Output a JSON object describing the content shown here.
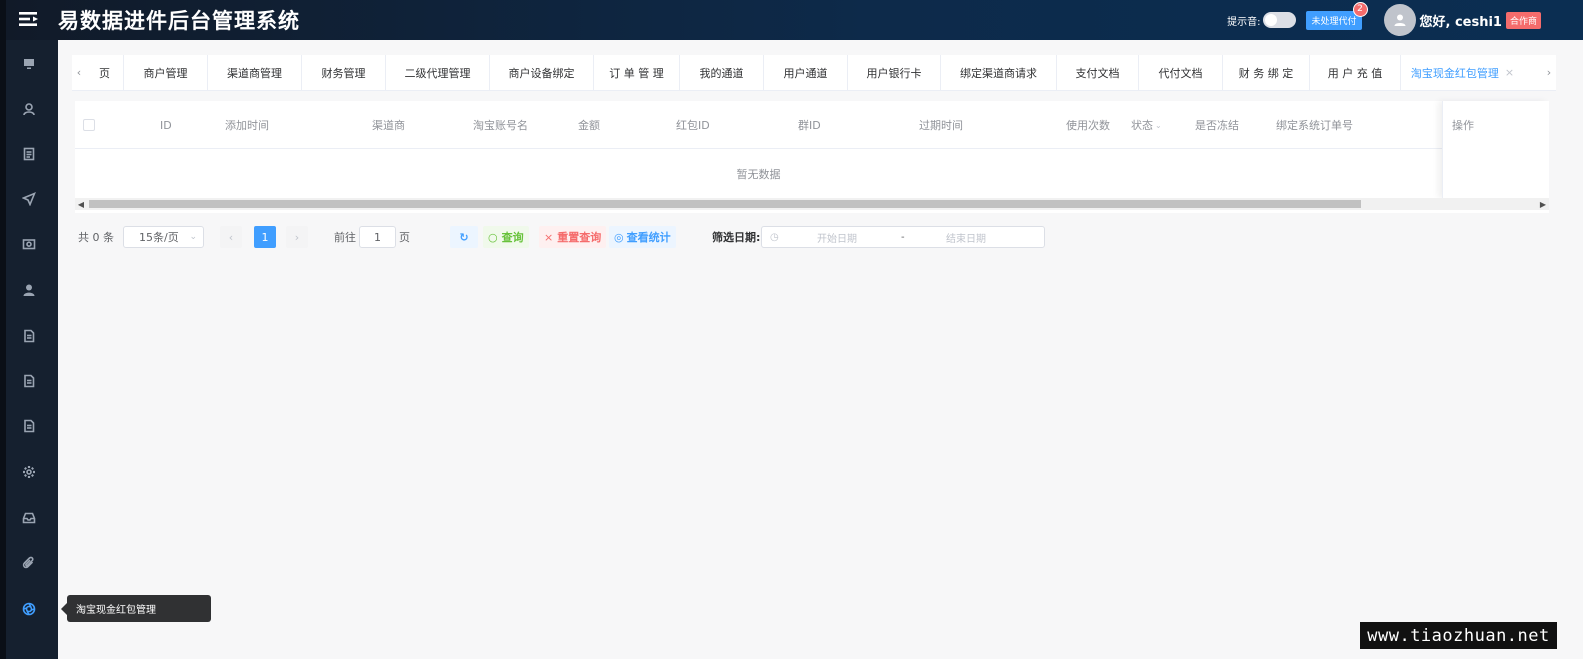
{
  "header": {
    "title": "易数据进件后台管理系统",
    "tone_label": "提示音:",
    "pending_button": "未处理代付",
    "pending_count": "2",
    "greeting": "您好, ceshi1",
    "role_badge": "合作商"
  },
  "sidebar": {
    "items": [
      {
        "icon": "monitor-icon"
      },
      {
        "icon": "user-icon"
      },
      {
        "icon": "document-icon"
      },
      {
        "icon": "send-icon"
      },
      {
        "icon": "wallet-icon"
      },
      {
        "icon": "person-icon"
      },
      {
        "icon": "file-icon"
      },
      {
        "icon": "file-icon"
      },
      {
        "icon": "file-icon"
      },
      {
        "icon": "gear-icon"
      },
      {
        "icon": "inbox-icon"
      },
      {
        "icon": "paperclip-icon"
      },
      {
        "icon": "aperture-icon",
        "active": true
      }
    ],
    "tooltip": "淘宝现金红包管理"
  },
  "tabs": {
    "items": [
      "页",
      "商户管理",
      "渠道商管理",
      "财务管理",
      "二级代理管理",
      "商户设备绑定",
      "订 单 管 理",
      "我的通道",
      "用户通道",
      "用户银行卡",
      "绑定渠道商请求",
      "支付文档",
      "代付文档",
      "财 务 绑 定",
      "用 户 充 值",
      "淘宝现金红包管理"
    ],
    "active_index": 15,
    "close_symbol": "×"
  },
  "table": {
    "columns": [
      "ID",
      "添加时间",
      "渠道商",
      "淘宝账号名",
      "金额",
      "红包ID",
      "群ID",
      "过期时间",
      "使用次数",
      "状态",
      "是否冻结",
      "绑定系统订单号",
      "操作"
    ],
    "empty_text": "暂无数据"
  },
  "pagination": {
    "total": "共 0 条",
    "page_size": "15条/页",
    "current_page": "1",
    "goto_prefix": "前往",
    "goto_value": "1",
    "goto_suffix": "页"
  },
  "actions": {
    "query": "查询",
    "reset": "重置查询",
    "stats": "查看统计"
  },
  "filter": {
    "label": "筛选日期:",
    "start_placeholder": "开始日期",
    "separator": "-",
    "end_placeholder": "结束日期"
  },
  "watermark": "www.tiaozhuan.net",
  "colors": {
    "primary": "#409eff",
    "success": "#67c23a",
    "danger": "#f56c6c",
    "header_bg": "#0d2a4a",
    "sidebar_bg": "#15202f"
  }
}
